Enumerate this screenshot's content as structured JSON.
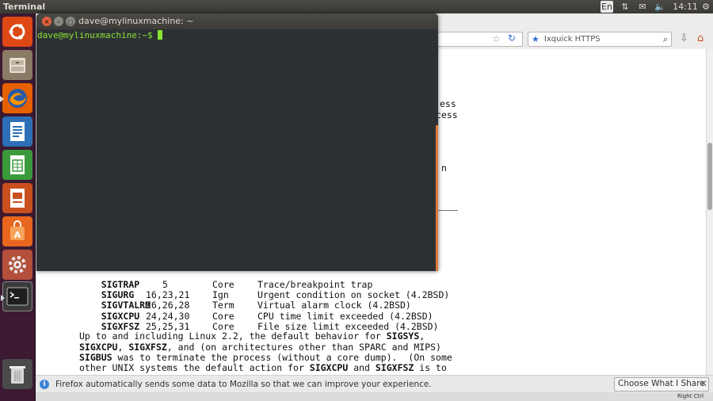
{
  "topbar": {
    "title": "Terminal",
    "lang": "En",
    "clock": "14:11"
  },
  "launcher": {
    "items": [
      {
        "name": "dash-home",
        "icon": "ubuntu-logo-icon",
        "color": "#dd4814"
      },
      {
        "name": "files",
        "icon": "file-cabinet-icon",
        "color": "#9b8b77"
      },
      {
        "name": "firefox",
        "icon": "firefox-icon",
        "color": "#e66000"
      },
      {
        "name": "libreoffice-writer",
        "icon": "writer-document-icon",
        "color": "#2d6fb7"
      },
      {
        "name": "libreoffice-calc",
        "icon": "calc-spreadsheet-icon",
        "color": "#3b9a3b"
      },
      {
        "name": "libreoffice-impress",
        "icon": "impress-presentation-icon",
        "color": "#c8501f"
      },
      {
        "name": "software-center",
        "icon": "shopping-bag-icon",
        "color": "#e8661d"
      },
      {
        "name": "system-settings",
        "icon": "settings-gears-icon",
        "color": "#b34f3b"
      },
      {
        "name": "terminal",
        "icon": "terminal-icon",
        "color": "#2e2e2e"
      },
      {
        "name": "trash",
        "icon": "trash-icon",
        "color": "#555555"
      }
    ]
  },
  "terminal": {
    "title": "dave@mylinuxmachine: ~",
    "prompt": "dave@mylinuxmachine:~$"
  },
  "browser": {
    "search_placeholder": "Ixquick HTTPS"
  },
  "page": {
    "fragments": [
      "ess",
      "cess",
      "n"
    ],
    "signals": [
      {
        "name": "SIGTRAP",
        "value": "5",
        "action": "Core",
        "comment": "Trace/breakpoint trap"
      },
      {
        "name": "SIGURG",
        "value": "16,23,21",
        "action": "Ign",
        "comment": "Urgent condition on socket (4.2BSD)"
      },
      {
        "name": "SIGVTALRM",
        "value": "26,26,28",
        "action": "Term",
        "comment": "Virtual alarm clock (4.2BSD)"
      },
      {
        "name": "SIGXCPU",
        "value": "24,24,30",
        "action": "Core",
        "comment": "CPU time limit exceeded (4.2BSD)"
      },
      {
        "name": "SIGXFSZ",
        "value": "25,25,31",
        "action": "Core",
        "comment": "File size limit exceeded (4.2BSD)"
      }
    ],
    "para": {
      "l1a": "Up to and including Linux 2.2, the default behavior for ",
      "l1b": "SIGSYS",
      "l1c": ",",
      "l2a": "SIGXCPU",
      "l2b": ", ",
      "l2c": "SIGXFSZ",
      "l2d": ", and (on architectures other than SPARC and MIPS)",
      "l3a": "SIGBUS",
      "l3b": " was to terminate the process (without a core dump).  (On some",
      "l4a": "other UNIX systems the default action for ",
      "l4b": "SIGXCPU",
      "l4c": " and ",
      "l4d": "SIGXFSZ",
      "l4e": " is to"
    }
  },
  "notification": {
    "message": "Firefox automatically sends some data to Mozilla so that we can improve your experience.",
    "button": "Choose What I Share",
    "close": "✕"
  },
  "status": {
    "right_ctrl": "Right Ctrl"
  }
}
